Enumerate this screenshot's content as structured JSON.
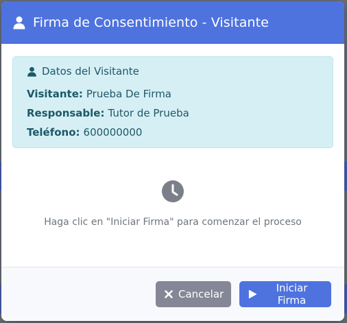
{
  "modal": {
    "title": "Firma de Consentimiento - Visitante",
    "header_icon": "user-icon"
  },
  "visitor_info": {
    "heading": "Datos del Visitante",
    "heading_icon": "user-icon",
    "rows": [
      {
        "label": "Visitante:",
        "value": "Prueba De Firma"
      },
      {
        "label": "Responsable:",
        "value": "Tutor de Prueba"
      },
      {
        "label": "Teléfono:",
        "value": "600000000"
      }
    ]
  },
  "status": {
    "icon": "clock-icon",
    "message": "Haga clic en \"Iniciar Firma\" para comenzar el proceso"
  },
  "footer": {
    "cancel_label": "Cancelar",
    "cancel_icon": "close-icon",
    "start_label": "Iniciar Firma",
    "start_icon": "play-icon"
  },
  "colors": {
    "primary": "#4e73df",
    "secondary": "#858796",
    "info_bg": "#d6eff5",
    "info_text": "#1c5966"
  }
}
